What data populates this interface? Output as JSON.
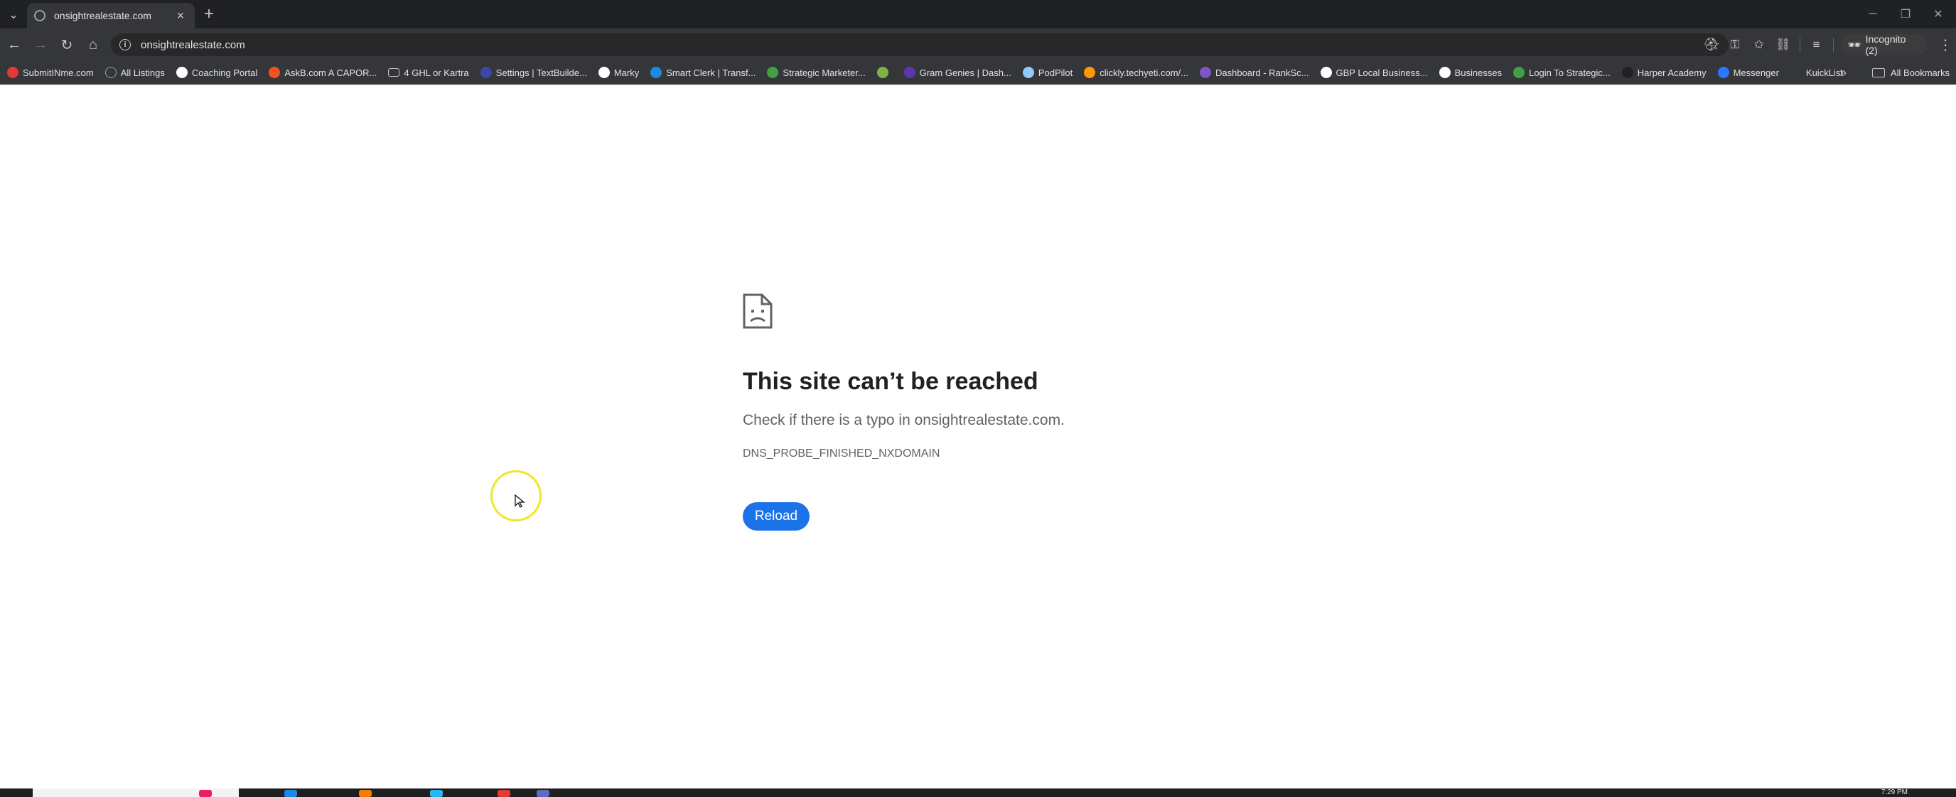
{
  "browser": {
    "tab": {
      "title": "onsightrealestate.com"
    },
    "address_bar": {
      "url": "onsightrealestate.com"
    },
    "profile": {
      "label": "Incognito (2)"
    }
  },
  "bookmarks": [
    {
      "label": "SubmitINme.com",
      "icon": "submit-favicon",
      "color": "#e53935"
    },
    {
      "label": "All Listings",
      "icon": "globe-icon",
      "color": "#9aa0a6"
    },
    {
      "label": "Coaching Portal",
      "icon": "portal-favicon",
      "color": "#ffffff"
    },
    {
      "label": "AskB.com A CAPOR...",
      "icon": "askb-favicon",
      "color": "#f4511e"
    },
    {
      "label": "4 GHL or Kartra",
      "icon": "folder-icon",
      "color": "#c7c7c7"
    },
    {
      "label": "Settings | TextBuilde...",
      "icon": "textbuilder-favicon",
      "color": "#3949ab"
    },
    {
      "label": "Marky",
      "icon": "marky-favicon",
      "color": "#ffffff"
    },
    {
      "label": "Smart Clerk | Transf...",
      "icon": "smartclerk-favicon",
      "color": "#1e88e5"
    },
    {
      "label": "Strategic Marketer...",
      "icon": "strategic-favicon",
      "color": "#43a047"
    },
    {
      "label": "",
      "icon": "house-favicon",
      "color": "#7cb342"
    },
    {
      "label": "Gram Genies | Dash...",
      "icon": "gramgenies-favicon",
      "color": "#5e35b1"
    },
    {
      "label": "PodPilot",
      "icon": "podpilot-favicon",
      "color": "#90caf9"
    },
    {
      "label": "clickly.techyeti.com/...",
      "icon": "clickly-favicon",
      "color": "#ff9800"
    },
    {
      "label": "Dashboard - RankSc...",
      "icon": "ranksc-favicon",
      "color": "#7e57c2"
    },
    {
      "label": "GBP Local Business...",
      "icon": "gbp-favicon",
      "color": "#ffffff"
    },
    {
      "label": "Businesses",
      "icon": "google-favicon",
      "color": "#ffffff"
    },
    {
      "label": "Login To Strategic...",
      "icon": "strategic-login-favicon",
      "color": "#43a047"
    },
    {
      "label": "Harper Academy",
      "icon": "harper-favicon",
      "color": "#212121"
    },
    {
      "label": "Messenger",
      "icon": "messenger-favicon",
      "color": "#2979ff"
    },
    {
      "label": "KuickList",
      "icon": "kuicklist-favicon",
      "color": "#35363a"
    }
  ],
  "bookmarks_all": "All Bookmarks",
  "error_page": {
    "title": "This site can’t be reached",
    "message": "Check if there is a typo in onsightrealestate.com.",
    "code": "DNS_PROBE_FINISHED_NXDOMAIN",
    "reload_label": "Reload"
  },
  "taskbar": {
    "clock": "7:29 PM"
  },
  "colors": {
    "accent": "#1a73e8",
    "chrome_dark": "#202124",
    "toolbar": "#35363a",
    "cursor_highlight": "#f2e627"
  }
}
